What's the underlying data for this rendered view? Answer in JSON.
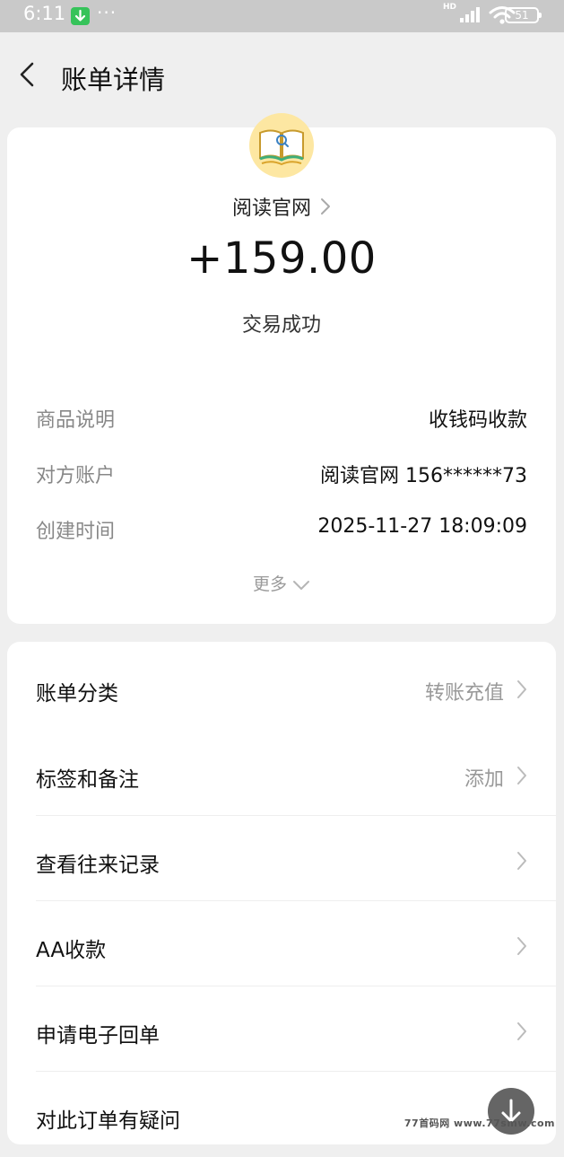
{
  "status_bar": {
    "time": "6:11",
    "dots": "···",
    "network": "HD",
    "battery": "51"
  },
  "header": {
    "title": "账单详情"
  },
  "transaction": {
    "merchant": "阅读官网",
    "amount": "+159.00",
    "status": "交易成功",
    "details": [
      {
        "label": "商品说明",
        "value": "收钱码收款"
      },
      {
        "label": "对方账户",
        "value": "阅读官网 156******73"
      },
      {
        "label": "创建时间",
        "value": "2025-11-27 18:09:09"
      }
    ],
    "more_label": "更多"
  },
  "menu": [
    {
      "label": "账单分类",
      "value": "转账充值"
    },
    {
      "label": "标签和备注",
      "value": "添加"
    },
    {
      "label": "查看往来记录",
      "value": ""
    },
    {
      "label": "AA收款",
      "value": ""
    },
    {
      "label": "申请电子回单",
      "value": ""
    },
    {
      "label": "对此订单有疑问",
      "value": ""
    }
  ],
  "watermark": "77首码网 www.77smw.com",
  "colors": {
    "background": "#efefef",
    "card": "#ffffff",
    "status_bar": "#c9c9c9",
    "download_badge": "#36c35a",
    "muted_text": "#888888"
  },
  "icons": {
    "back": "chevron-left-icon",
    "merchant_logo": "book-logo-icon",
    "row_chevron": "chevron-right-icon",
    "more_chevron": "chevron-down-icon",
    "float_button": "download-arrow-icon"
  }
}
